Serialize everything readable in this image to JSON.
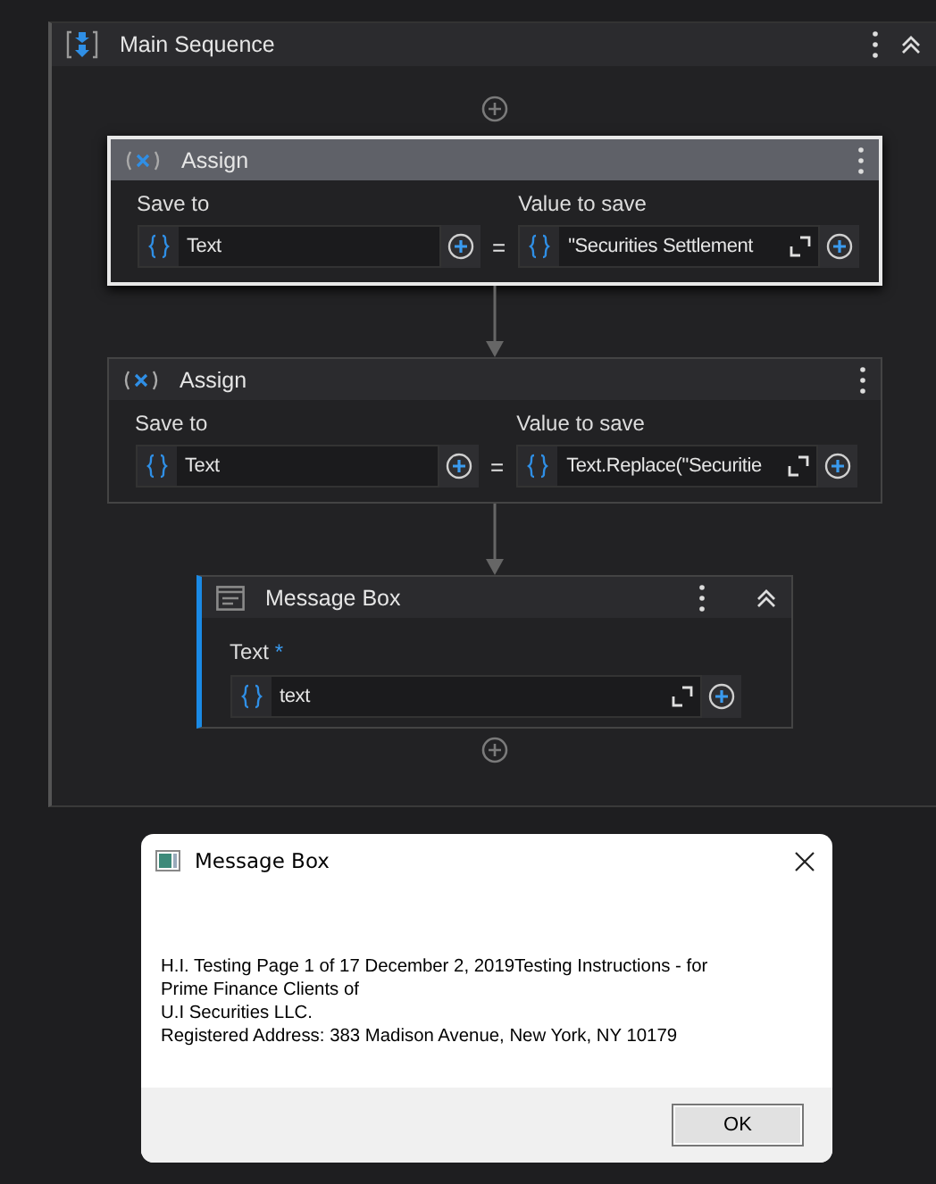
{
  "sequence": {
    "title": "Main Sequence",
    "activities": [
      {
        "kind": "assign",
        "title": "Assign",
        "selected": true,
        "save_to_label": "Save to",
        "save_to": "Text",
        "equals": "=",
        "value_label": "Value to save",
        "value": "\"Securities Settlement"
      },
      {
        "kind": "assign",
        "title": "Assign",
        "selected": false,
        "save_to_label": "Save to",
        "save_to": "Text",
        "equals": "=",
        "value_label": "Value to save",
        "value": "Text.Replace(\"Securitie"
      },
      {
        "kind": "message_box",
        "title": "Message Box",
        "selected": false,
        "field_label": "Text",
        "required_mark": "*",
        "value": "text"
      }
    ]
  },
  "dialog": {
    "title": "Message Box",
    "message": "H.I. Testing Page 1 of 17 December 2, 2019Testing Instructions - for\nPrime Finance Clients of\nU.I Securities LLC.\nRegistered Address: 383 Madison Avenue, New York, NY 10179",
    "button": "OK"
  }
}
